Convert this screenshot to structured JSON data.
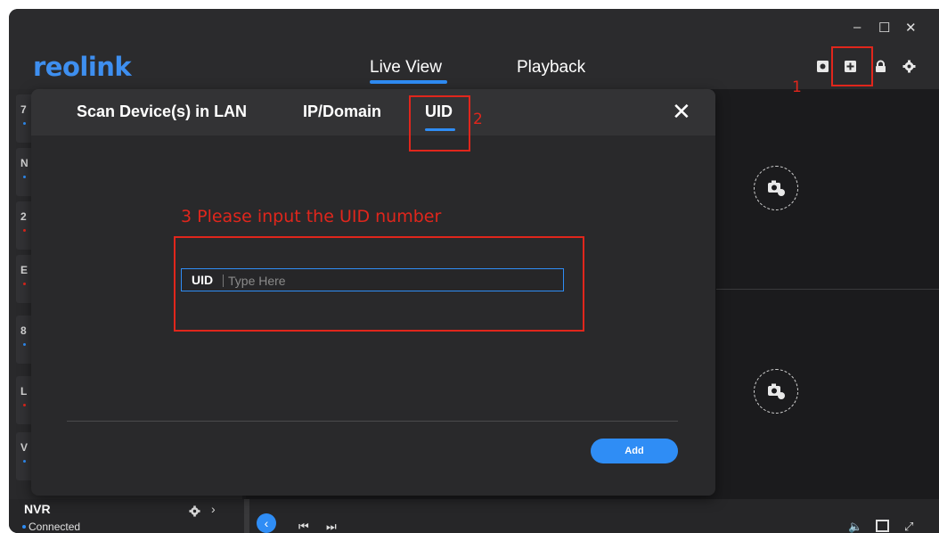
{
  "app": {
    "logo": "reolink",
    "window_controls": {
      "minimize": "–",
      "maximize": "☐",
      "close": "✕"
    },
    "nav_tabs": [
      {
        "label": "Live View",
        "active": true
      },
      {
        "label": "Playback",
        "active": false
      }
    ],
    "toolbar_icons": [
      "snapshot-icon",
      "add-device-icon",
      "lock-icon",
      "settings-icon"
    ]
  },
  "sidebar": {
    "items": [
      {
        "letter": "7",
        "status_color": "#2f8df5"
      },
      {
        "letter": "N",
        "status_color": "#2f8df5"
      },
      {
        "letter": "2",
        "status_color": "#e0261c"
      },
      {
        "letter": "E",
        "status_color": "#e0261c"
      },
      {
        "letter": "8",
        "status_color": "#2f8df5"
      },
      {
        "letter": "L",
        "status_color": "#e0261c"
      },
      {
        "letter": "V",
        "status_color": "#2f8df5"
      }
    ],
    "device": {
      "name": "NVR",
      "status": "Connected"
    }
  },
  "dialog": {
    "tabs": [
      {
        "label": "Scan Device(s) in LAN",
        "active": false
      },
      {
        "label": "IP/Domain",
        "active": false
      },
      {
        "label": "UID",
        "active": true
      }
    ],
    "close": "✕",
    "uid_label": "UID",
    "uid_placeholder": "Type Here",
    "uid_value": "",
    "add_button": "Add"
  },
  "annotations": {
    "step1": "1",
    "step2": "2",
    "step3": "3 Please input the UID number"
  },
  "colors": {
    "accent": "#2f8df5",
    "annotation": "#e0261c",
    "background": "#1f1f21"
  }
}
